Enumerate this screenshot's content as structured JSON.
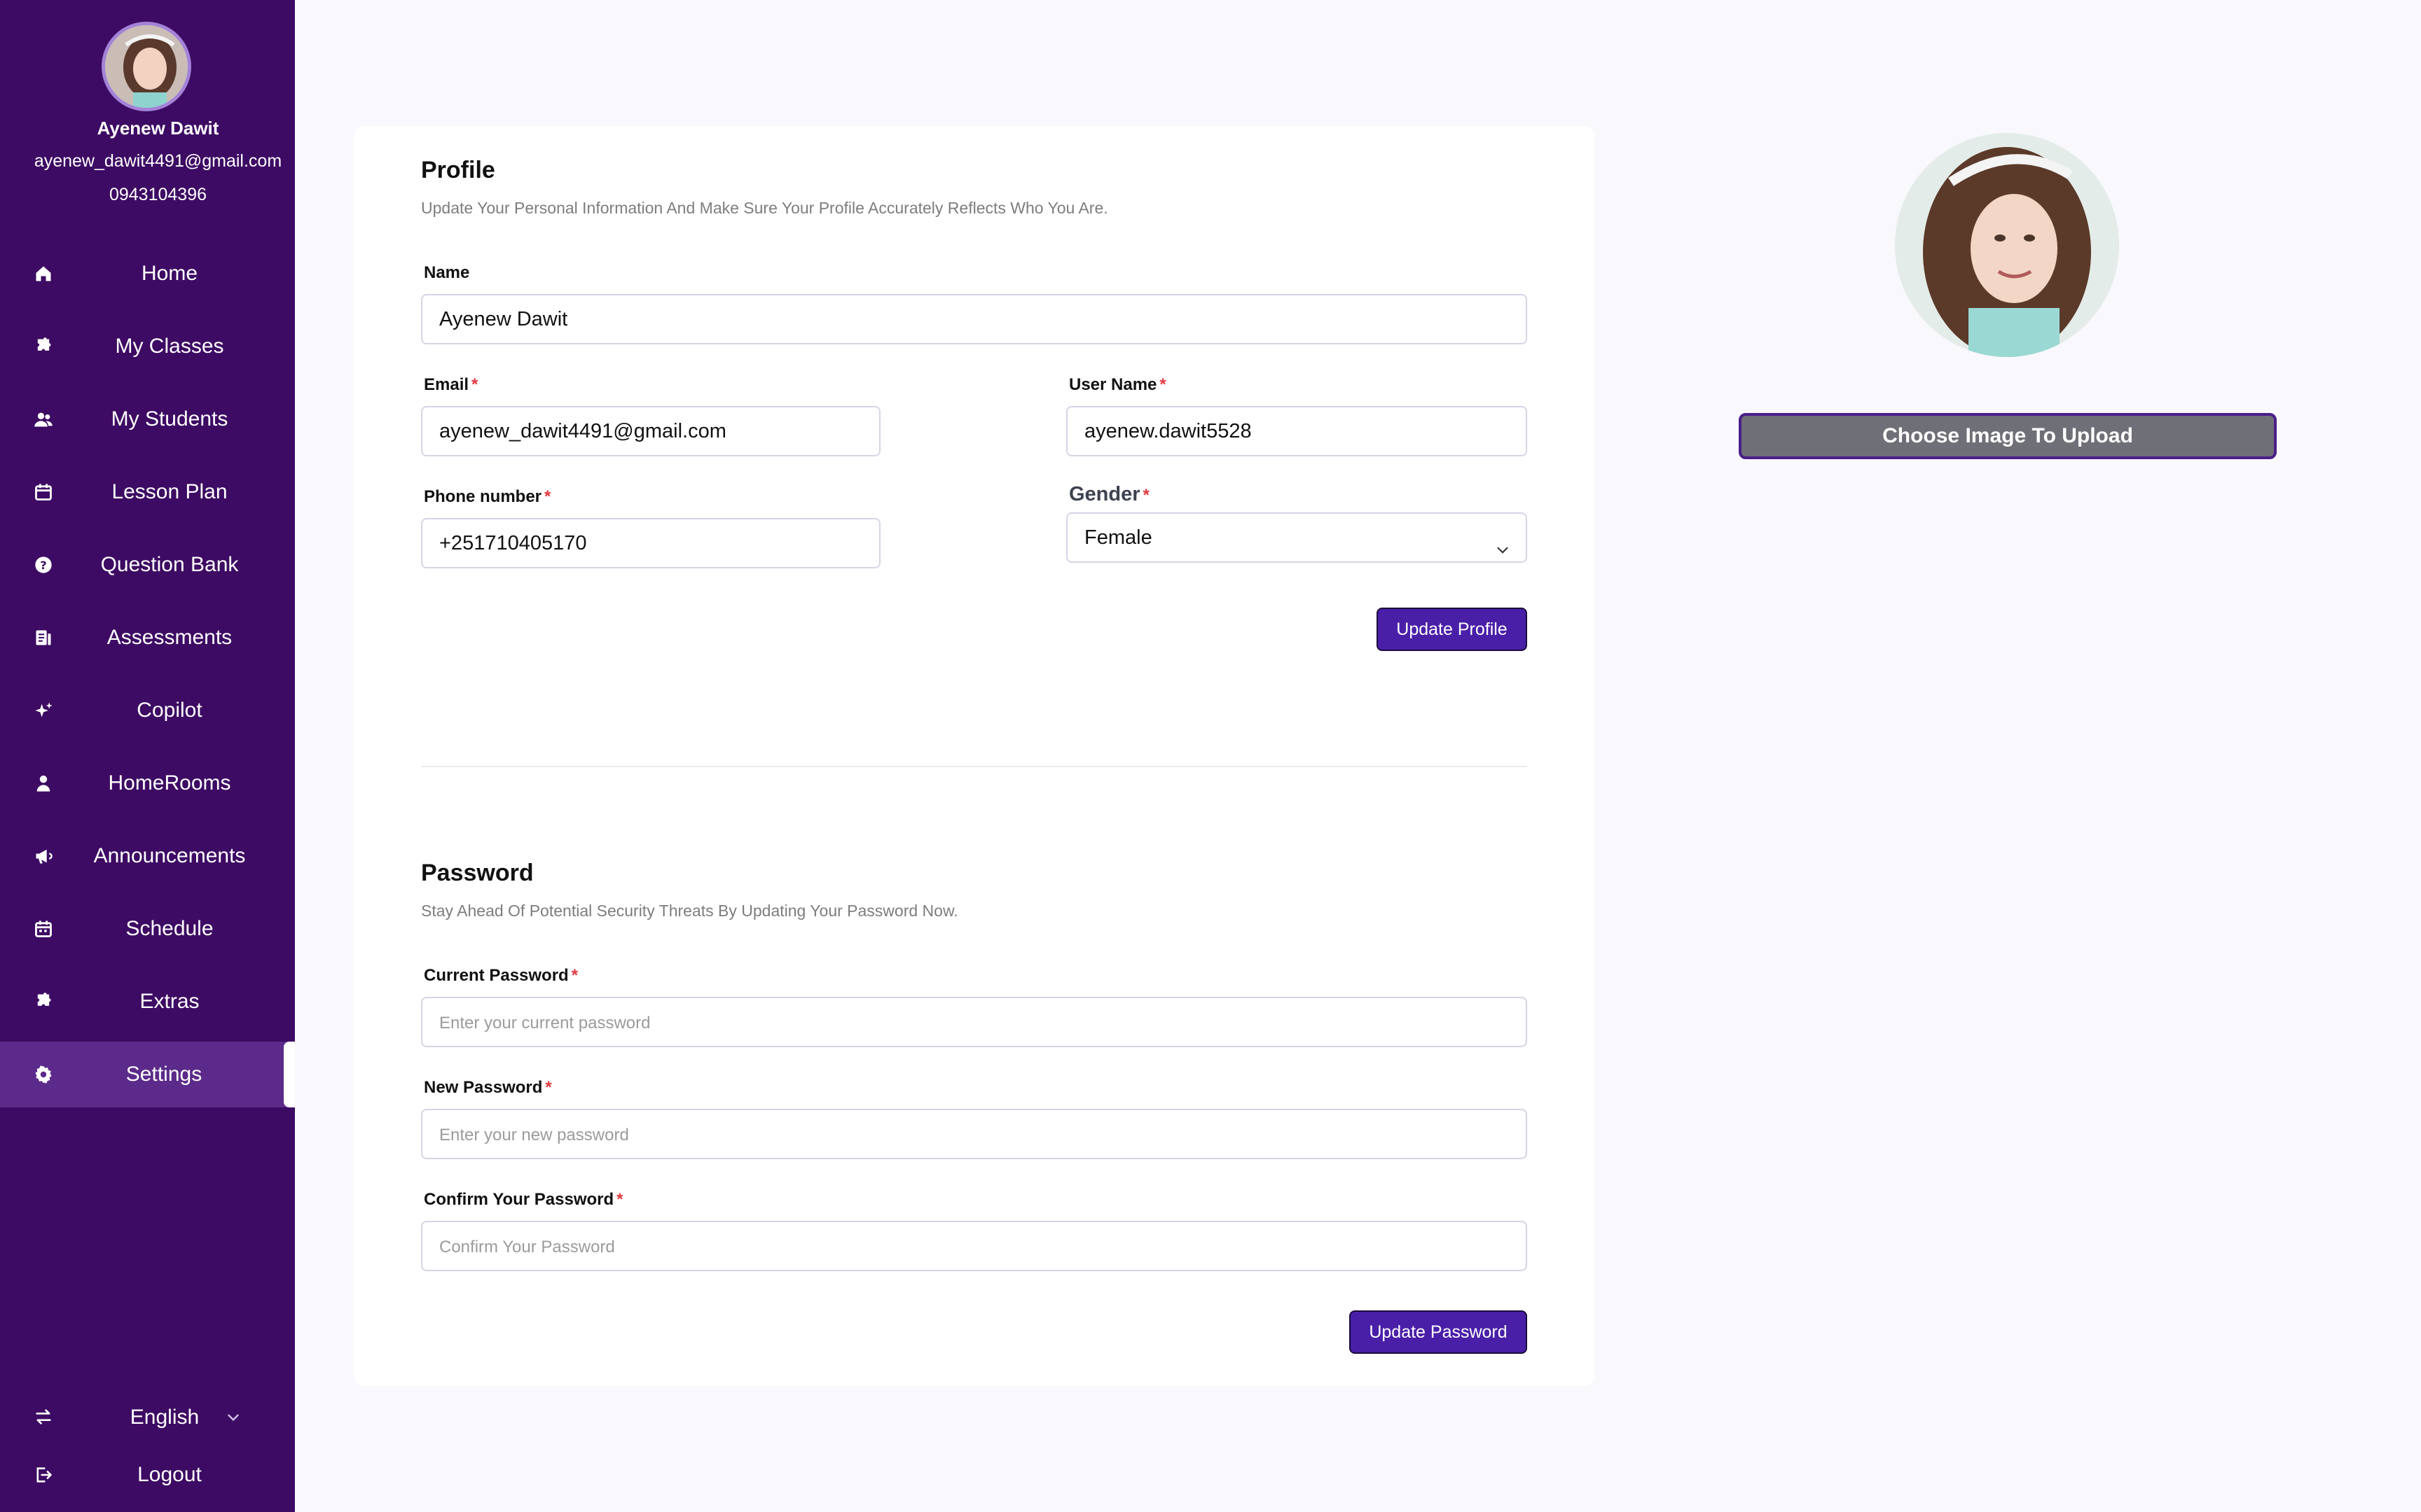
{
  "user": {
    "name": "Ayenew Dawit",
    "email": "ayenew_dawit4491@gmail.com",
    "phone": "0943104396"
  },
  "sidebar": {
    "items": [
      {
        "label": "Home",
        "icon": "home-icon"
      },
      {
        "label": "My Classes",
        "icon": "puzzle-icon"
      },
      {
        "label": "My Students",
        "icon": "users-icon"
      },
      {
        "label": "Lesson Plan",
        "icon": "calendar-icon"
      },
      {
        "label": "Question Bank",
        "icon": "question-circle-icon"
      },
      {
        "label": "Assessments",
        "icon": "assessment-icon"
      },
      {
        "label": "Copilot",
        "icon": "sparkles-icon"
      },
      {
        "label": "HomeRooms",
        "icon": "user-icon"
      },
      {
        "label": "Announcements",
        "icon": "megaphone-icon"
      },
      {
        "label": "Schedule",
        "icon": "schedule-icon"
      },
      {
        "label": "Extras",
        "icon": "puzzle-icon"
      },
      {
        "label": "Settings",
        "icon": "gear-icon",
        "active": true
      }
    ],
    "language": "English",
    "logout": "Logout"
  },
  "profile": {
    "title": "Profile",
    "subtitle": "Update Your Personal Information And Make Sure Your Profile Accurately Reflects Who You Are.",
    "name_label": "Name",
    "name_value": "Ayenew Dawit",
    "email_label": "Email",
    "email_value": "ayenew_dawit4491@gmail.com",
    "username_label": "User Name",
    "username_value": "ayenew.dawit5528",
    "phone_label": "Phone number",
    "phone_value": "+251710405170",
    "gender_label": "Gender",
    "gender_value": "Female",
    "update_button": "Update Profile"
  },
  "password": {
    "title": "Password",
    "subtitle": "Stay Ahead Of Potential Security Threats By Updating Your Password Now.",
    "current_label": "Current Password",
    "current_placeholder": "Enter your current password",
    "new_label": "New Password",
    "new_placeholder": "Enter your new password",
    "confirm_label": "Confirm Your Password",
    "confirm_placeholder": "Confirm Your Password",
    "update_button": "Update Password"
  },
  "image_panel": {
    "upload_button": "Choose Image To Upload"
  },
  "colors": {
    "sidebar_bg": "#3d0b63",
    "active_item": "#5b2a8a",
    "primary": "#4a1fa8",
    "required": "#e0393e"
  }
}
